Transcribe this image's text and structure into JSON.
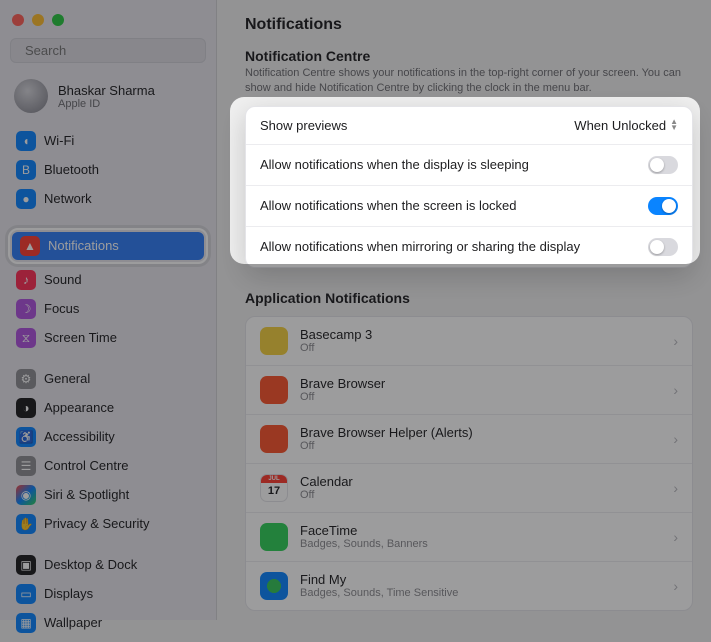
{
  "window": {
    "title": "Notifications"
  },
  "search": {
    "placeholder": "Search"
  },
  "user": {
    "name": "Bhaskar Sharma",
    "sub": "Apple ID"
  },
  "sidebar": {
    "items_primary": [
      {
        "icon": "wifi-icon",
        "label": "Wi-Fi",
        "color": "ic-blue"
      },
      {
        "icon": "bluetooth-icon",
        "label": "Bluetooth",
        "color": "ic-blue"
      },
      {
        "icon": "network-icon",
        "label": "Network",
        "color": "ic-blue"
      }
    ],
    "selected": {
      "icon": "bell-icon",
      "label": "Notifications",
      "color": "ic-red"
    },
    "items_secondary": [
      {
        "icon": "sound-icon",
        "label": "Sound",
        "color": "ic-pink"
      },
      {
        "icon": "focus-icon",
        "label": "Focus",
        "color": "ic-purple"
      },
      {
        "icon": "screentime-icon",
        "label": "Screen Time",
        "color": "ic-purple"
      }
    ],
    "items_tertiary": [
      {
        "icon": "gear-icon",
        "label": "General",
        "color": "ic-gray"
      },
      {
        "icon": "appearance-icon",
        "label": "Appearance",
        "color": "ic-dark"
      },
      {
        "icon": "accessibility-icon",
        "label": "Accessibility",
        "color": "ic-blue"
      },
      {
        "icon": "control-centre-icon",
        "label": "Control Centre",
        "color": "ic-gray"
      },
      {
        "icon": "siri-icon",
        "label": "Siri & Spotlight",
        "color": "ic-teal"
      },
      {
        "icon": "privacy-icon",
        "label": "Privacy & Security",
        "color": "ic-blue"
      }
    ],
    "items_quaternary": [
      {
        "icon": "desktop-icon",
        "label": "Desktop & Dock",
        "color": "ic-dark"
      },
      {
        "icon": "displays-icon",
        "label": "Displays",
        "color": "ic-blue"
      },
      {
        "icon": "wallpaper-icon",
        "label": "Wallpaper",
        "color": "ic-blue"
      }
    ]
  },
  "header": {
    "centre_label": "Notification Centre",
    "centre_desc": "Notification Centre shows your notifications in the top-right corner of your screen. You can show and hide Notification Centre by clicking the clock in the menu bar."
  },
  "options": {
    "previews_label": "Show previews",
    "previews_value": "When Unlocked",
    "sleep_label": "Allow notifications when the display is sleeping",
    "sleep_on": false,
    "locked_label": "Allow notifications when the screen is locked",
    "locked_on": true,
    "mirror_label": "Allow notifications when mirroring or sharing the display",
    "mirror_on": false
  },
  "apps": {
    "section_label": "Application Notifications",
    "list": [
      {
        "name": "Basecamp 3",
        "sub": "Off",
        "icon": "i-basecamp"
      },
      {
        "name": "Brave Browser",
        "sub": "Off",
        "icon": "i-brave"
      },
      {
        "name": "Brave Browser Helper (Alerts)",
        "sub": "Off",
        "icon": "i-brave"
      },
      {
        "name": "Calendar",
        "sub": "Off",
        "icon": "i-cal"
      },
      {
        "name": "FaceTime",
        "sub": "Badges, Sounds, Banners",
        "icon": "i-facetime"
      },
      {
        "name": "Find My",
        "sub": "Badges, Sounds, Time Sensitive",
        "icon": "i-findmy"
      }
    ]
  }
}
